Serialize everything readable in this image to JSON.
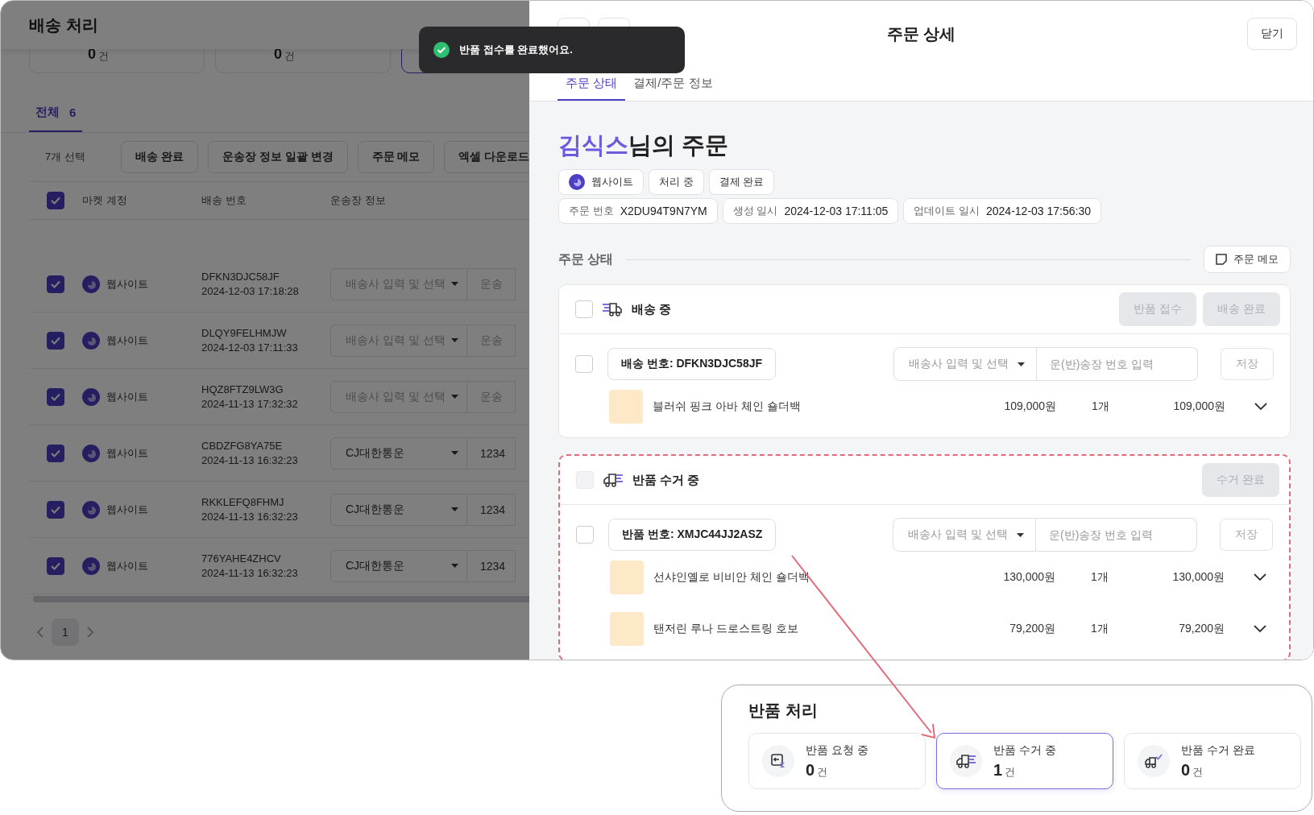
{
  "page": {
    "title": "배송 처리",
    "stat_cards": [
      {
        "value": "0",
        "unit": "건",
        "selected": false
      },
      {
        "value": "0",
        "unit": "건",
        "selected": false
      },
      {
        "selected": true
      }
    ],
    "tabs": [
      {
        "label": "전체",
        "count": "6",
        "selected": true
      }
    ],
    "toolbar": {
      "selection": "7개 선택",
      "buttons": [
        "배송 완료",
        "운송장 정보 일괄 변경",
        "주문 메모",
        "엑셀 다운로드"
      ]
    },
    "table": {
      "header_checked": true,
      "columns": [
        "마켓 계정",
        "배송 번호",
        "운송장 정보"
      ],
      "rows": [
        {
          "checked": true,
          "market": "웹사이트",
          "shipment_no": "DFKN3DJC58JF",
          "date": "2024-12-03 17:18:28",
          "carrier_placeholder": "배송사 입력 및 선택",
          "tracking_placeholder": "운송"
        },
        {
          "checked": true,
          "market": "웹사이트",
          "shipment_no": "DLQY9FELHMJW",
          "date": "2024-12-03 17:11:33",
          "carrier_placeholder": "배송사 입력 및 선택",
          "tracking_placeholder": "운송"
        },
        {
          "checked": true,
          "market": "웹사이트",
          "shipment_no": "HQZ8FTZ9LW3G",
          "date": "2024-11-13 17:32:32",
          "carrier_placeholder": "배송사 입력 및 선택",
          "tracking_placeholder": "운송"
        },
        {
          "checked": true,
          "market": "웹사이트",
          "shipment_no": "CBDZFG8YA75E",
          "date": "2024-11-13 16:32:23",
          "carrier": "CJ대한통운",
          "tracking": "1234"
        },
        {
          "checked": true,
          "market": "웹사이트",
          "shipment_no": "RKKLEFQ8FHMJ",
          "date": "2024-11-13 16:32:23",
          "carrier": "CJ대한통운",
          "tracking": "1234"
        },
        {
          "checked": true,
          "market": "웹사이트",
          "shipment_no": "776YAHE4ZHCV",
          "date": "2024-11-13 16:32:23",
          "carrier": "CJ대한통운",
          "tracking": "1234"
        }
      ]
    },
    "pagination": [
      {
        "label": "1",
        "selected": true
      }
    ]
  },
  "toast": {
    "message": "반품 접수를 완료했어요."
  },
  "drawer": {
    "title": "주문 상세",
    "close_button": "닫기",
    "tabs": [
      {
        "label": "주문 상태",
        "selected": true
      },
      {
        "label": "결제/주문 정보",
        "selected": false
      }
    ],
    "customer_name": "김식스",
    "title_suffix": "님의 주문",
    "badges": [
      {
        "label": "웹사이트",
        "kind": "channel"
      },
      {
        "label": "처리 중",
        "kind": "plain"
      },
      {
        "label": "결제 완료",
        "kind": "plain"
      }
    ],
    "info": [
      {
        "label": "주문 번호",
        "value": "X2DU94T9N7YM"
      },
      {
        "label": "생성 일시",
        "value": "2024-12-03 17:11:05"
      },
      {
        "label": "업데이트 일시",
        "value": "2024-12-03 17:56:30"
      }
    ],
    "section": {
      "title": "주문 상태",
      "memo_button": "주문 메모"
    },
    "groups": [
      {
        "status": "배송 중",
        "kind": "shipping",
        "checked": false,
        "disabled": false,
        "highlighted": false,
        "actions": [
          {
            "label": "반품 접수",
            "disabled": true
          },
          {
            "label": "배송 완료",
            "disabled": true
          }
        ],
        "shipments": [
          {
            "checked": false,
            "number": "배송 번호: DFKN3DJC58JF",
            "carrier_placeholder": "배송사 입력 및 선택",
            "tracking_placeholder": "운(반)송장 번호 입력",
            "save_button": "저장",
            "items": [
              {
                "name": "블러쉬 핑크 아바 체인 숄더백",
                "price": "109,000원",
                "qty": "1개",
                "total": "109,000원"
              }
            ]
          }
        ]
      },
      {
        "status": "반품 수거 중",
        "kind": "return",
        "checked": false,
        "disabled": true,
        "highlighted": true,
        "actions": [
          {
            "label": "수거 완료",
            "disabled": true
          }
        ],
        "shipments": [
          {
            "checked": false,
            "number": "반품 번호: XMJC44JJ2ASZ",
            "carrier_placeholder": "배송사 입력 및 선택",
            "tracking_placeholder": "운(반)송장 번호 입력",
            "save_button": "저장",
            "items": [
              {
                "name": "선샤인옐로 비비안 체인 숄더백",
                "price": "130,000원",
                "qty": "1개",
                "total": "130,000원"
              },
              {
                "name": "탠저린 루나 드로스트링 호보",
                "price": "79,200원",
                "qty": "1개",
                "total": "79,200원"
              }
            ]
          }
        ]
      }
    ]
  },
  "callout": {
    "title": "반품 처리",
    "cards": [
      {
        "label": "반품 요청 중",
        "value": "0",
        "unit": "건",
        "kind": "request",
        "selected": false
      },
      {
        "label": "반품 수거 중",
        "value": "1",
        "unit": "건",
        "kind": "pickup",
        "selected": true
      },
      {
        "label": "반품 수거 완료",
        "value": "0",
        "unit": "건",
        "kind": "done",
        "selected": false
      }
    ]
  }
}
